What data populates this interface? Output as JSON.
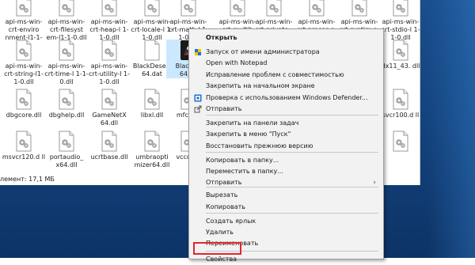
{
  "files": [
    {
      "name": "api-ms-win-crt-enviro nment-l1-1-0.dll",
      "type": "dll"
    },
    {
      "name": "api-ms-win-crt-filesyst em-l1-1-0.dll",
      "type": "dll"
    },
    {
      "name": "api-ms-win-crt-heap-l 1-1-0.dll",
      "type": "dll"
    },
    {
      "name": "api-ms-win-crt-locale-l 1-1-0.dll",
      "type": "dll"
    },
    {
      "name": "api-ms-win-crt-math-l 1-1-0.dll",
      "type": "dll"
    },
    {
      "name": "api-ms-win-crt-multib yte-l1-1-0.dll",
      "type": "dll"
    },
    {
      "name": "api-ms-win-crt-private -l1-1-0.dll",
      "type": "dll"
    },
    {
      "name": "api-ms-win-crt-proces s-l1-1-0.dll",
      "type": "dll"
    },
    {
      "name": "api-ms-win-crt-runtim e-l1-1-0.dll",
      "type": "dll"
    },
    {
      "name": "api-ms-win-crt-stdio-l 1-1-0.dll",
      "type": "dll"
    },
    {
      "name": "api-ms-win-crt-string-l1-1-0.dll",
      "type": "dll"
    },
    {
      "name": "api-ms-win-crt-time-l 1-1-0.dll",
      "type": "dll"
    },
    {
      "name": "api-ms-win-crt-utility-l 1-1-0.dll",
      "type": "dll"
    },
    {
      "name": "BlackDesert 64.dat",
      "type": "dat"
    },
    {
      "name": "BlackDe 64.ex",
      "type": "exe"
    },
    {
      "name": "dx11_43. dll",
      "type": "dll"
    },
    {
      "name": "dbgcore.dll",
      "type": "dll"
    },
    {
      "name": "dbghelp.dll",
      "type": "dll"
    },
    {
      "name": "GameNetX 64.dll",
      "type": "dll"
    },
    {
      "name": "libxl.dll",
      "type": "dll"
    },
    {
      "name": "mfc140",
      "type": "dll"
    },
    {
      "name": "svcr100.d ll",
      "type": "dll"
    },
    {
      "name": "msvcr120.d ll",
      "type": "dll"
    },
    {
      "name": "portaudio_ x64.dll",
      "type": "dll"
    },
    {
      "name": "ucrtbase.dll",
      "type": "dll"
    },
    {
      "name": "umbraopti mizer64.dll",
      "type": "dll"
    },
    {
      "name": "vccorlib",
      "type": "dll"
    },
    {
      "name": "",
      "type": "dll"
    }
  ],
  "status_text": "лемент: 17,1 МБ",
  "menu": {
    "items": [
      {
        "label": "Открыть",
        "bold": true,
        "icon": ""
      },
      {
        "label": "Запуск от имени администратора",
        "icon": "shield-icon"
      },
      {
        "label": "Open with Notepad",
        "icon": ""
      },
      {
        "label": "Исправление проблем с совместимостью",
        "icon": ""
      },
      {
        "label": "Закрепить на начальном экране",
        "icon": ""
      },
      {
        "label": "Проверка с использованием Windows Defender...",
        "icon": "defender-icon"
      },
      {
        "label": "Отправить",
        "icon": "share-icon"
      },
      {
        "label": "Закрепить на панели задач",
        "icon": ""
      },
      {
        "label": "Закрепить в меню \"Пуск\"",
        "icon": ""
      },
      {
        "label": "Восстановить прежнюю версию",
        "icon": ""
      },
      {
        "label": "Копировать в папку...",
        "icon": ""
      },
      {
        "label": "Переместить в папку...",
        "icon": ""
      },
      {
        "label": "Отправить",
        "icon": "",
        "submenu": true
      },
      {
        "label": "Вырезать",
        "icon": ""
      },
      {
        "label": "Копировать",
        "icon": ""
      },
      {
        "label": "Создать ярлык",
        "icon": ""
      },
      {
        "label": "Удалить",
        "icon": ""
      },
      {
        "label": "Переименовать",
        "icon": ""
      },
      {
        "label": "Свойства",
        "icon": ""
      }
    ]
  },
  "colors": {
    "highlight_box": "#e0262c",
    "selection": "#cce8ff",
    "desktop": "#14447f"
  }
}
